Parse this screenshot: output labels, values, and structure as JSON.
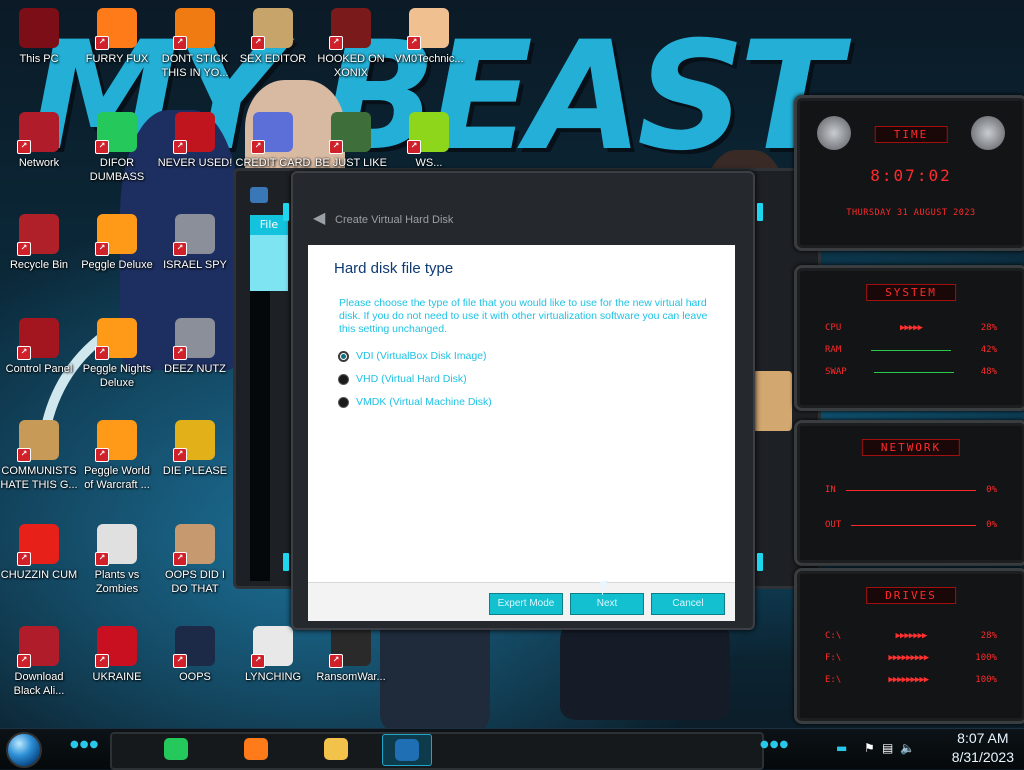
{
  "wallpaper": {
    "text": "MY BEAST"
  },
  "desktop_icons": [
    {
      "label": "This PC",
      "icon": "computer-icon",
      "color": "#7b0e16"
    },
    {
      "label": "FURRY FUX",
      "icon": "firefox-icon",
      "color": "#ff7a18"
    },
    {
      "label": "DONT STICK THIS IN YO...",
      "icon": "vlc-cone-icon",
      "color": "#f07b12"
    },
    {
      "label": "SEX EDITOR",
      "icon": "hxd-editor-icon",
      "color": "#c6a46a"
    },
    {
      "label": "HOOKED ON XONIX",
      "icon": "xonix-game-icon",
      "color": "#7a1a1a"
    },
    {
      "label": "VM0Technic...",
      "icon": "doctor-avatar-icon",
      "color": "#f0c090"
    },
    {
      "label": "Network",
      "icon": "network-alien-icon",
      "color": "#b01c2a"
    },
    {
      "label": "DIFOR DUMBASS",
      "icon": "discord-app-icon",
      "color": "#25c85a"
    },
    {
      "label": "NEVER USED!",
      "icon": "dev-cpp-icon",
      "color": "#c0141e"
    },
    {
      "label": "CREDIT CARD STEALER",
      "icon": "credit-card-icon",
      "color": "#5c6fd8"
    },
    {
      "label": "BE JUST LIKE",
      "icon": "santa-icon",
      "color": "#3e6e3a"
    },
    {
      "label": "WS...",
      "icon": "lime-icon",
      "color": "#8ed61c"
    },
    {
      "label": "Recycle Bin",
      "icon": "recycle-bin-icon",
      "color": "#b02028"
    },
    {
      "label": "Peggle Deluxe",
      "icon": "peggle-icon",
      "color": "#ff9a18"
    },
    {
      "label": "ISRAEL SPY",
      "icon": "folder-network-icon",
      "color": "#8a8f99"
    },
    {
      "label": "Control Panel",
      "icon": "control-panel-icon",
      "color": "#a31620"
    },
    {
      "label": "Peggle Nights Deluxe",
      "icon": "peggle-nights-icon",
      "color": "#ff9a18"
    },
    {
      "label": "DEEZ NUTZ",
      "icon": "window-stack-icon",
      "color": "#8a8f99"
    },
    {
      "label": "COMMUNISTS HATE THIS G...",
      "icon": "money-bag-icon",
      "color": "#c89a58"
    },
    {
      "label": "Peggle World of Warcraft ...",
      "icon": "peggle-wow-icon",
      "color": "#ff9a18"
    },
    {
      "label": "DIE PLEASE",
      "icon": "de-app-icon",
      "color": "#e2b018"
    },
    {
      "label": "CHUZZIN CUM",
      "icon": "chuzzle-icon",
      "color": "#e8201a"
    },
    {
      "label": "Plants vs Zombies",
      "icon": "plants-vs-zombies-icon",
      "color": "#e0e0e0"
    },
    {
      "label": "OOPS DID I DO THAT",
      "icon": "portrait-icon",
      "color": "#c69a6e"
    },
    {
      "label": "Download Black Ali...",
      "icon": "alien-download-icon",
      "color": "#b01c2a"
    },
    {
      "label": "UKRAINE",
      "icon": "radiation-icon",
      "color": "#c81020"
    },
    {
      "label": "OOPS",
      "icon": "monitor-icon",
      "color": "#1c2a48"
    },
    {
      "label": "LYNCHING",
      "icon": "noose-icon",
      "color": "#e8e8e8"
    },
    {
      "label": "RansomWar...",
      "icon": "skull-icon",
      "color": "#2a2a2a"
    }
  ],
  "gadgets": {
    "time": {
      "title": "TIME",
      "clock": "8:07:02",
      "date": "THURSDAY 31 AUGUST 2023"
    },
    "system": {
      "title": "SYSTEM",
      "rows": [
        {
          "label": "CPU",
          "value": "28%"
        },
        {
          "label": "RAM",
          "value": "42%"
        },
        {
          "label": "SWAP",
          "value": "48%"
        }
      ]
    },
    "network": {
      "title": "NETWORK",
      "rows": [
        {
          "label": "IN",
          "value": "0%"
        },
        {
          "label": "OUT",
          "value": "0%"
        }
      ]
    },
    "drives": {
      "title": "DRIVES",
      "rows": [
        {
          "label": "C:\\",
          "value": "28%"
        },
        {
          "label": "F:\\",
          "value": "100%"
        },
        {
          "label": "E:\\",
          "value": "100%"
        }
      ]
    }
  },
  "vbox_manager": {
    "tab_file": "File"
  },
  "dialog": {
    "header": "Create Virtual Hard Disk",
    "title": "Hard disk file type",
    "description": "Please choose the type of file that you would like to use for the new virtual hard disk. If you do not need to use it with other virtualization software you can leave this setting unchanged.",
    "options": [
      {
        "label": "VDI (VirtualBox Disk Image)",
        "selected": true
      },
      {
        "label": "VHD (Virtual Hard Disk)",
        "selected": false
      },
      {
        "label": "VMDK (Virtual Machine Disk)",
        "selected": false
      }
    ],
    "buttons": {
      "expert": "Expert Mode",
      "next": "Next",
      "cancel": "Cancel"
    }
  },
  "taskbar": {
    "apps": [
      {
        "name": "discord-taskbar-icon",
        "color": "#25c85a"
      },
      {
        "name": "firefox-taskbar-icon",
        "color": "#ff7a18"
      },
      {
        "name": "file-explorer-taskbar-icon",
        "color": "#f2c24a"
      },
      {
        "name": "virtualbox-taskbar-icon",
        "color": "#1f6fb4"
      }
    ],
    "time": "8:07 AM",
    "date": "8/31/2023"
  }
}
